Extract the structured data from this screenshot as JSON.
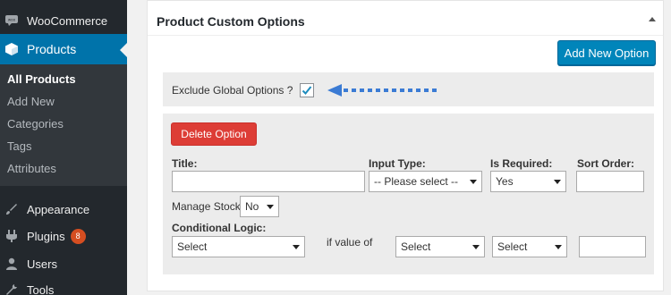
{
  "sidebar": {
    "woocommerce_label": "WooCommerce",
    "products_label": "Products",
    "submenu": [
      "All Products",
      "Add New",
      "Categories",
      "Tags",
      "Attributes"
    ],
    "appearance_label": "Appearance",
    "plugins_label": "Plugins",
    "plugins_badge": "8",
    "users_label": "Users",
    "tools_label": "Tools"
  },
  "panel": {
    "title": "Product Custom Options",
    "add_button": "Add New Option",
    "exclude_label": "Exclude Global Options ?",
    "exclude_checked": true,
    "delete_button": "Delete Option",
    "title_label": "Title:",
    "title_value": "",
    "input_type_label": "Input Type:",
    "input_type_value": "-- Please select --",
    "is_required_label": "Is Required:",
    "is_required_value": "Yes",
    "sort_order_label": "Sort Order:",
    "sort_order_value": "",
    "manage_stock_label": "Manage Stock",
    "manage_stock_value": "No",
    "conditional_label": "Conditional Logic:",
    "conditional_value": "Select",
    "if_value_label": "if value of",
    "select_a": "Select",
    "select_b": "Select",
    "last_value": ""
  },
  "colors": {
    "accent_blue": "#0085ba",
    "delete_red": "#dd3d36",
    "sidebar_dark": "#23282d",
    "arrow_blue": "#3b7bd4"
  },
  "icons": [
    "woocommerce-icon",
    "products-icon",
    "appearance-icon",
    "plugins-icon",
    "users-icon",
    "tools-icon",
    "checkmark-icon",
    "collapse-arrow-icon"
  ]
}
